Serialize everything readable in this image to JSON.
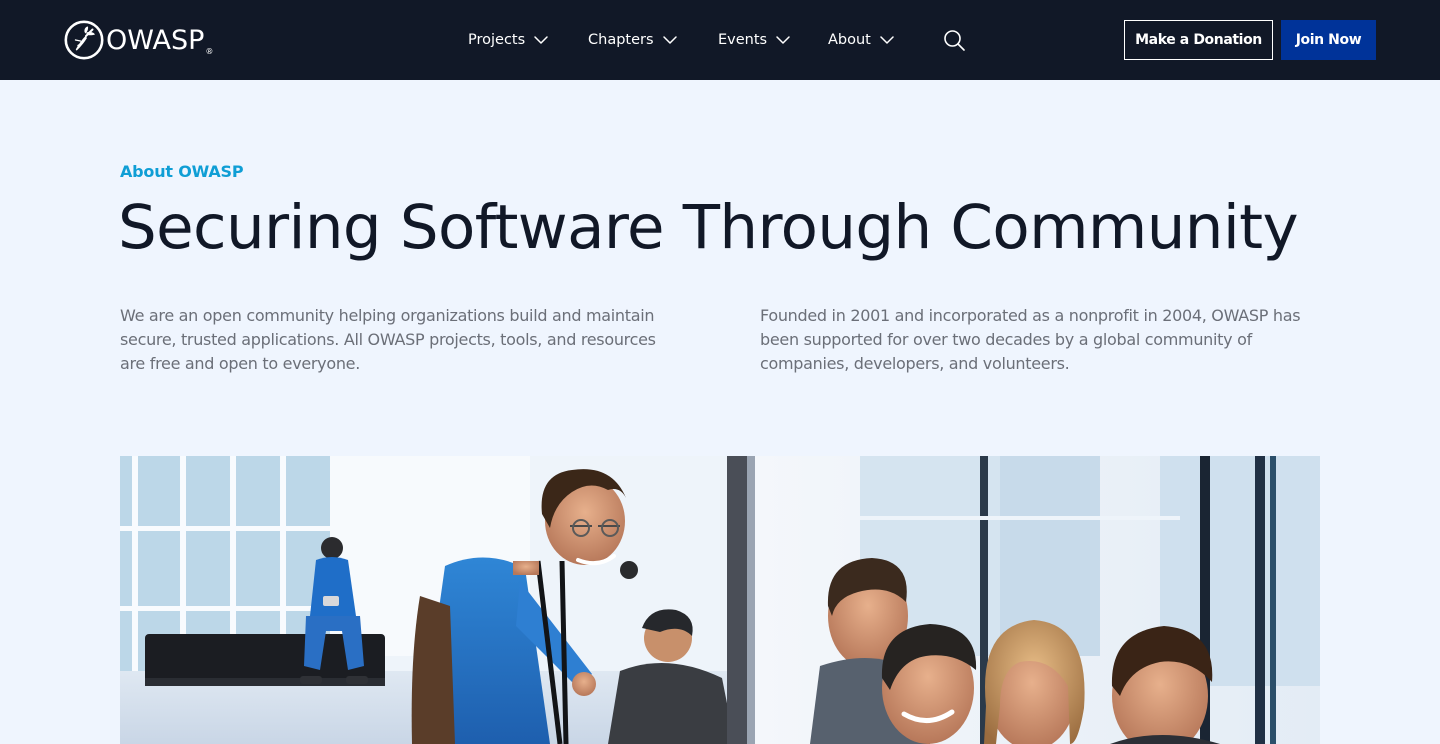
{
  "header": {
    "logo_text": "OWASP",
    "logo_mark": "®",
    "nav": [
      {
        "label": "Projects"
      },
      {
        "label": "Chapters"
      },
      {
        "label": "Events"
      },
      {
        "label": "About"
      }
    ],
    "search_icon": "search-icon",
    "donate_label": "Make a Donation",
    "join_label": "Join Now"
  },
  "hero": {
    "eyebrow": "About OWASP",
    "title": "Securing Software Through Community",
    "intro_left": "We are an open community helping organizations build and maintain secure, trusted applications. All OWASP projects, tools, and resources are free and open to everyone.",
    "intro_right": "Founded in 2001 and incorporated as a nonprofit in 2004, OWASP has been supported for over two decades by a global community of companies, developers, and volunteers."
  },
  "photo": {
    "subject": "community-photo"
  },
  "colors": {
    "header_bg": "#111827",
    "page_bg": "#eff5fe",
    "accent": "#0f9ed5",
    "join_button": "#003399",
    "heading": "#111827",
    "body_text": "#6b6f78"
  }
}
